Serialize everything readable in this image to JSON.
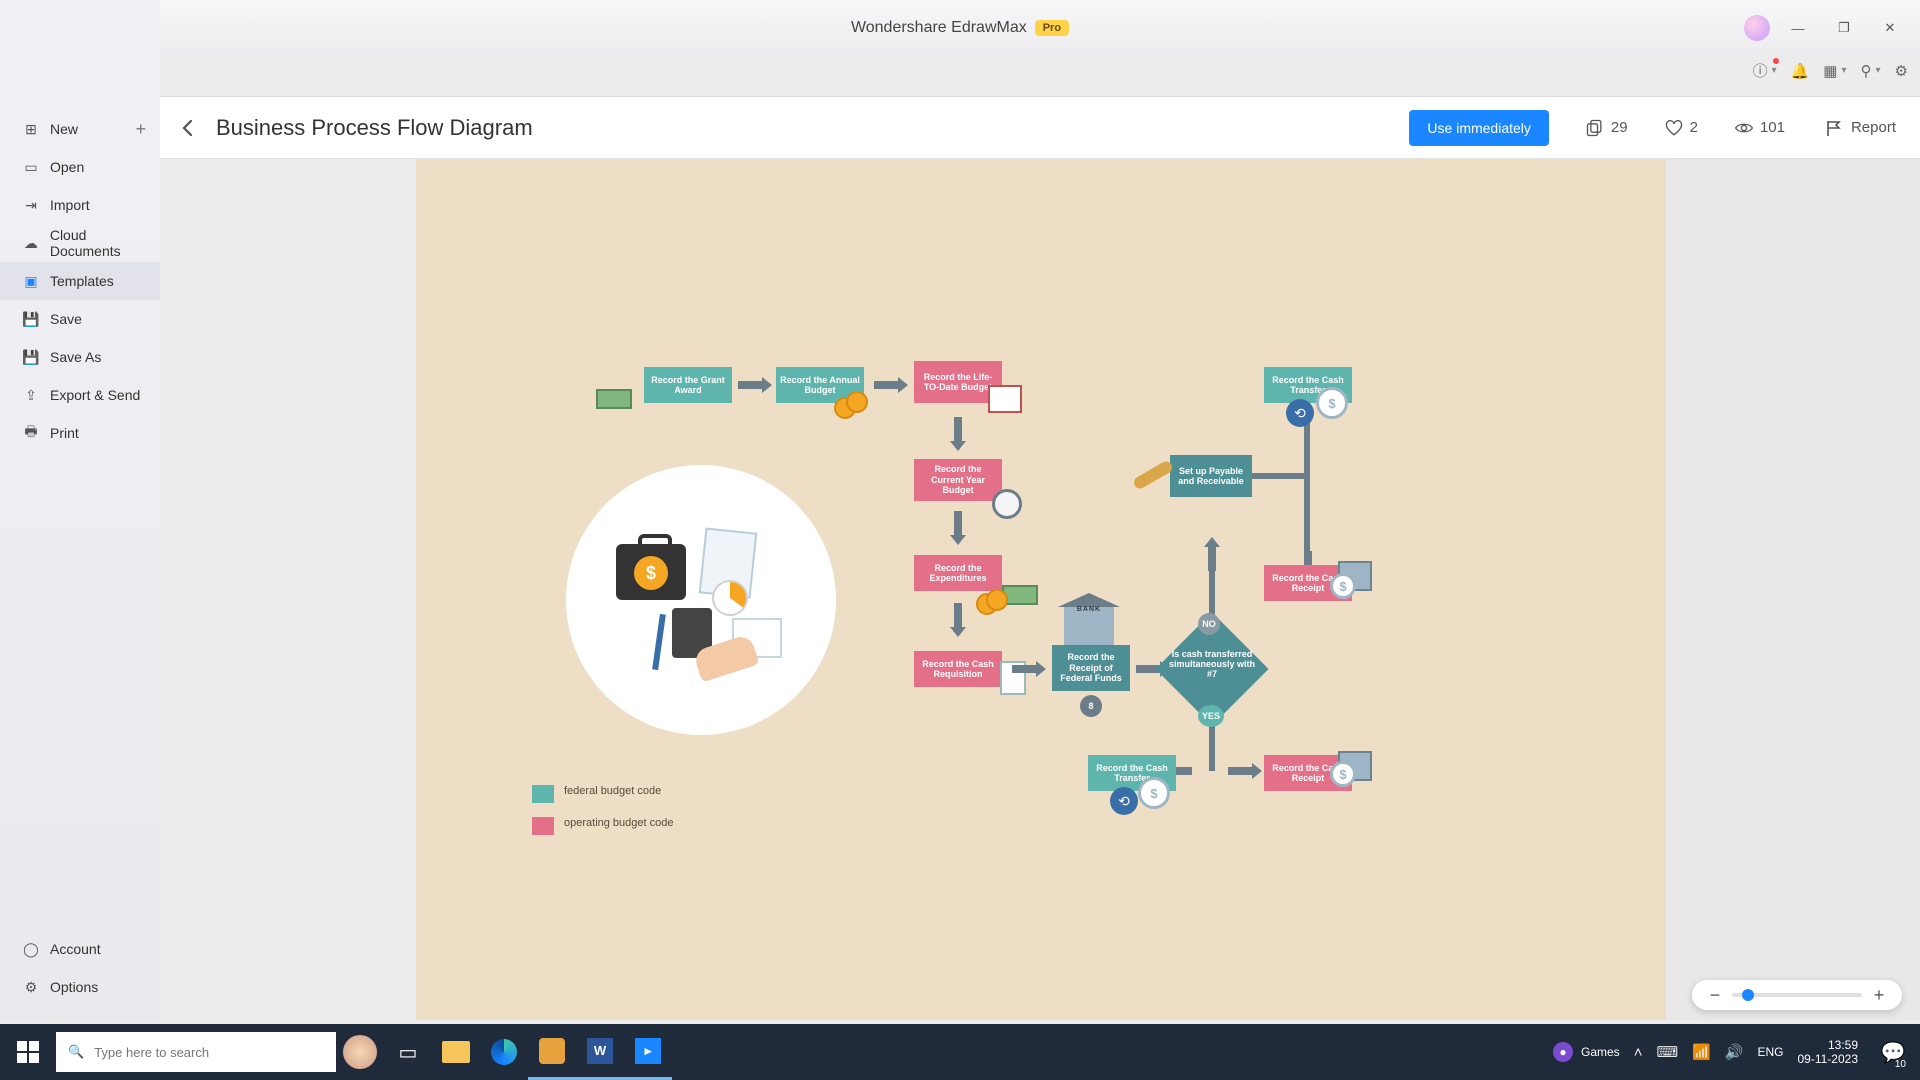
{
  "app": {
    "name": "Wondershare EdrawMax",
    "badge": "Pro"
  },
  "window_controls": {
    "minimize": "—",
    "maximize": "❐",
    "close": "✕"
  },
  "sidebar": {
    "items": [
      {
        "label": "New",
        "icon": "plus-square",
        "has_plus": true
      },
      {
        "label": "Open",
        "icon": "folder"
      },
      {
        "label": "Import",
        "icon": "import"
      },
      {
        "label": "Cloud Documents",
        "icon": "cloud"
      },
      {
        "label": "Templates",
        "icon": "template",
        "active": true
      },
      {
        "label": "Save",
        "icon": "save"
      },
      {
        "label": "Save As",
        "icon": "save-as"
      },
      {
        "label": "Export & Send",
        "icon": "export"
      },
      {
        "label": "Print",
        "icon": "print"
      }
    ],
    "bottom": [
      {
        "label": "Account",
        "icon": "account"
      },
      {
        "label": "Options",
        "icon": "gear"
      }
    ]
  },
  "template": {
    "title": "Business Process Flow Diagram",
    "use_button": "Use immediately",
    "stats": {
      "copies": 29,
      "likes": 2,
      "views": 101
    },
    "report_label": "Report"
  },
  "diagram": {
    "boxes": {
      "b1": "Record the Grant Award",
      "b2": "Record the Annual Budget",
      "b3": "Record the Life-TO-Date Budget",
      "b4": "Record the Current Year Budget",
      "b5": "Record the Expenditures",
      "b6": "Record the Cash Requisition",
      "b7": "Record the Receipt of Federal Funds",
      "b7_badge": "8",
      "b8": "Record the Cash Transfer",
      "b9": "Set up Payable and Receivable",
      "b10": "Record the Cash Receipt",
      "b11": "Record the Cash Transfer",
      "b12": "Record the Cash Receipt"
    },
    "decision": {
      "text": "Is cash transferred simultaneously with #7",
      "yes": "YES",
      "no": "NO"
    },
    "legend": {
      "a": "federal budget code",
      "b": "operating budget code"
    }
  },
  "taskbar": {
    "search_placeholder": "Type here to search",
    "games_label": "Games",
    "ime": "ENG",
    "time": "13:59",
    "date": "09-11-2023",
    "notif_count": "10"
  }
}
